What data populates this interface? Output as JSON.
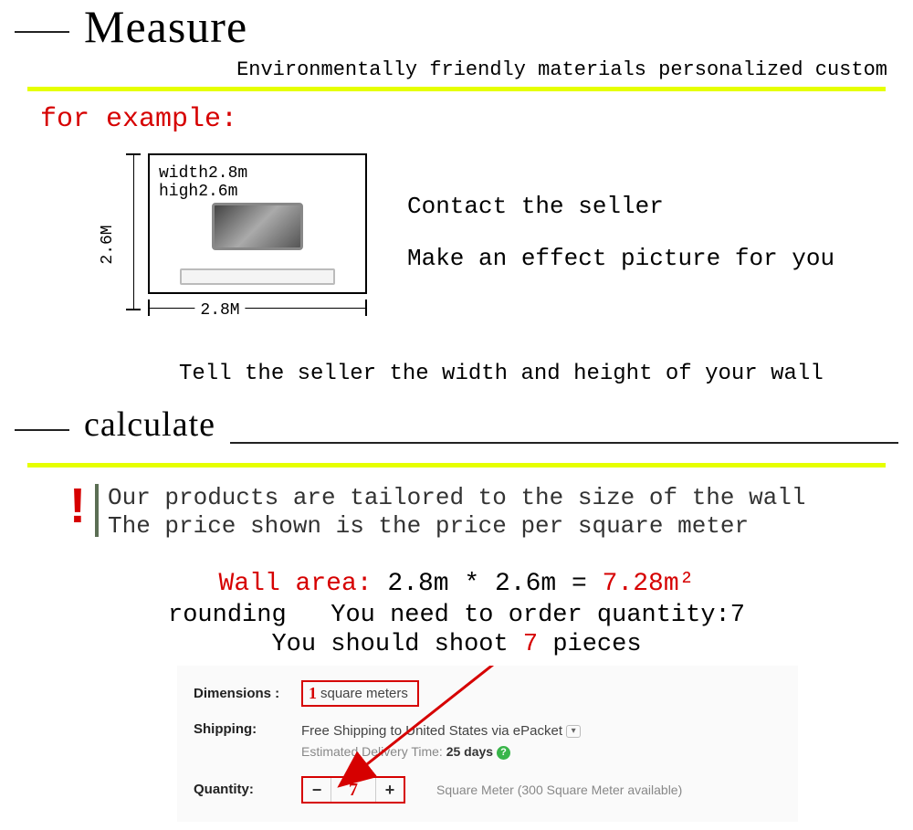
{
  "header": {
    "title": "Measure",
    "subtitle": "Environmentally friendly materials personalized custom"
  },
  "example": {
    "label": "for example:",
    "width_label": "width2.8m",
    "height_label": "high2.6m",
    "h_dim": "2.8M",
    "v_dim": "2.6M",
    "contact_line1": "Contact the seller",
    "contact_line2": "Make an effect picture for you",
    "tell_seller": "Tell the seller the width and height of your wall"
  },
  "calculate": {
    "title": "calculate",
    "notice_line1": "Our products are tailored to the size of the wall",
    "notice_line2": "The price shown is the price per square meter",
    "formula_label": "Wall area:",
    "formula_expr": "2.8m * 2.6m =",
    "formula_result": "7.28m²",
    "rounding_prefix": "rounding",
    "rounding_text": "You need to order quantity:7",
    "shoot_prefix": "You should shoot",
    "shoot_pieces": "7",
    "shoot_suffix": "pieces"
  },
  "panel": {
    "dimensions_label": "Dimensions :",
    "dimensions_value_num": "1",
    "dimensions_value_unit": "square meters",
    "shipping_label": "Shipping:",
    "shipping_text": "Free Shipping to United States via ePacket",
    "shipping_eta_prefix": "Estimated Delivery Time:",
    "shipping_eta_days": "25 days",
    "quantity_label": "Quantity:",
    "quantity_value": "7",
    "availability": "Square Meter (300 Square Meter available)"
  }
}
